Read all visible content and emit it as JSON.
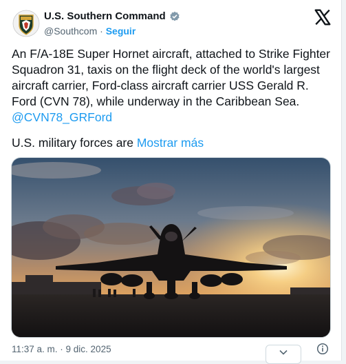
{
  "author": {
    "name": "U.S. Southern Command",
    "handle": "@Southcom",
    "separator": "·",
    "follow_label": "Seguir"
  },
  "post": {
    "text": "An F/A-18E Super Hornet aircraft, attached to Strike Fighter Squadron 31, taxis on the flight deck of the world's largest aircraft carrier, Ford-class aircraft carrier USS Gerald R. Ford (CVN 78), while underway in the Caribbean Sea. ",
    "mention": "@CVN78_GRFord",
    "second_line": "U.S. military forces are ",
    "show_more": "Mostrar más"
  },
  "footer": {
    "timestamp": "11:37 a. m. · 9 dic. 2025"
  },
  "icons": {
    "avatar": "southcom-seal-icon",
    "verified": "verified-badge-icon",
    "brand": "x-logo-icon",
    "menu": "chevron-down-icon",
    "info": "info-icon"
  },
  "colors": {
    "accent": "#1d9bf0",
    "text": "#0f1419",
    "muted": "#536471"
  }
}
